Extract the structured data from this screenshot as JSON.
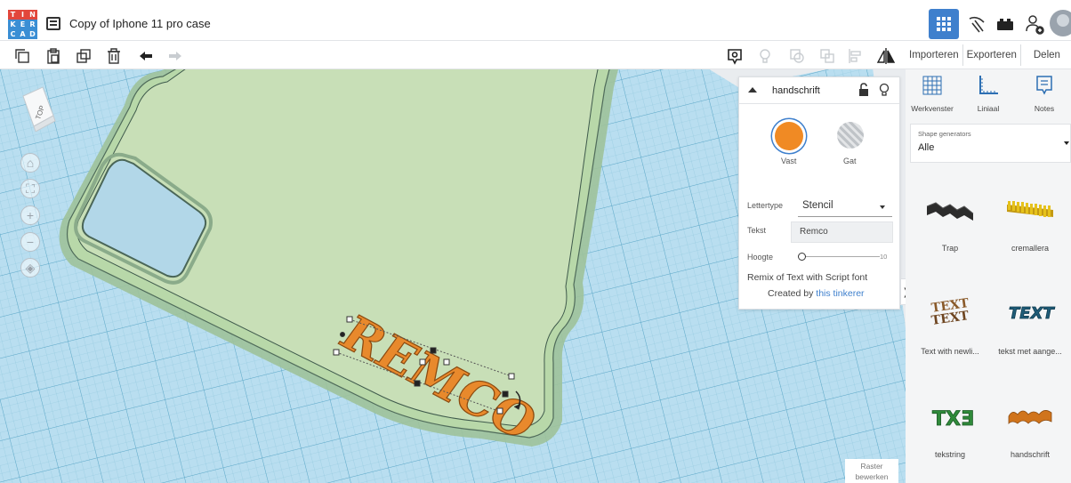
{
  "header": {
    "logo_letters": [
      "T",
      "I",
      "N",
      "K",
      "E",
      "R",
      "C",
      "A",
      "D"
    ],
    "logo_colors": [
      "#e2463b",
      "#e2463b",
      "#e2463b",
      "#3a8ed4",
      "#3a8ed4",
      "#3a8ed4",
      "#3a8ed4",
      "#3a8ed4",
      "#3a8ed4"
    ],
    "title": "Copy of Iphone 11 pro case",
    "icons": [
      "3d-view-icon",
      "pickaxe-icon",
      "bricks-icon",
      "add-user-icon"
    ]
  },
  "toolbar": {
    "edit_icons": [
      "copy-icon",
      "paste-icon",
      "duplicate-icon",
      "trash-icon",
      "undo-icon",
      "redo-icon"
    ],
    "shape_icons": [
      "notes-bubble-icon",
      "light-bulb-icon",
      "group-icon",
      "ungroup-icon",
      "align-icon",
      "mirror-icon"
    ]
  },
  "right_toolbar": {
    "import": "Importeren",
    "export": "Exporteren",
    "share": "Delen"
  },
  "canvas": {
    "viewcube_label": "TOP",
    "nav": [
      "home-icon",
      "fit-icon",
      "zoom-in-icon",
      "zoom-out-icon",
      "orthographic-icon"
    ],
    "edit_grid": "Raster\nbewerken",
    "phone_text": "REMCO",
    "accent": "#e8892c",
    "phone_color": "#c8dfb7",
    "grid_color": "#a9d6e8"
  },
  "inspector": {
    "shape_name": "handschrift",
    "solid_label": "Vast",
    "hole_label": "Gat",
    "solid_color": "#f08a24",
    "font_label": "Lettertype",
    "font_value": "Stencil",
    "text_label": "Tekst",
    "text_value": "Remco",
    "height_label": "Hoogte",
    "height_value": 0,
    "height_max": "10",
    "description": "Remix of Text with Script font",
    "credit_prefix": "Created by ",
    "credit_link": "this tinkerer"
  },
  "panel": {
    "tools": [
      {
        "label": "Werkvenster",
        "icon": "workplane-icon"
      },
      {
        "label": "Liniaal",
        "icon": "ruler-icon"
      },
      {
        "label": "Notes",
        "icon": "notes-icon"
      }
    ],
    "generators_label": "Shape generators",
    "generators_value": "Alle",
    "shapes": [
      {
        "label": "Trap",
        "icon": "stairs-shape-icon"
      },
      {
        "label": "cremallera",
        "icon": "rack-shape-icon"
      },
      {
        "label": "Text with newli...",
        "icon": "text-newline-shape-icon"
      },
      {
        "label": "tekst met aange...",
        "icon": "text-custom-shape-icon"
      },
      {
        "label": "tekstring",
        "icon": "text-ring-shape-icon"
      },
      {
        "label": "handschrift",
        "icon": "handwriting-shape-icon"
      }
    ]
  }
}
